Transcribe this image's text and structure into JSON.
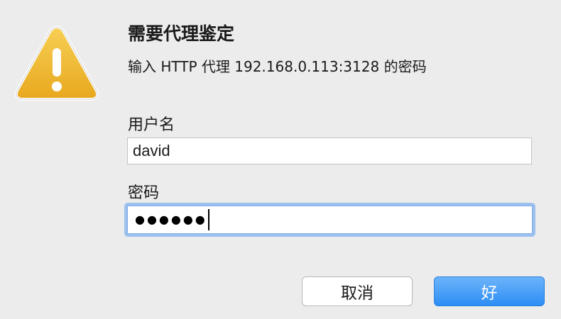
{
  "dialog": {
    "title": "需要代理鉴定",
    "message": "输入 HTTP 代理 192.168.0.113:3128 的密码",
    "icon": "warning-icon",
    "colors": {
      "background": "#ececec",
      "accent": "#2d8ef5",
      "focus_ring": "#9cc1ef",
      "warning_fill": "#f0b429"
    }
  },
  "form": {
    "username_label": "用户名",
    "username_value": "david",
    "password_label": "密码",
    "password_masked": "●●●●●●"
  },
  "buttons": {
    "cancel_label": "取消",
    "ok_label": "好"
  }
}
